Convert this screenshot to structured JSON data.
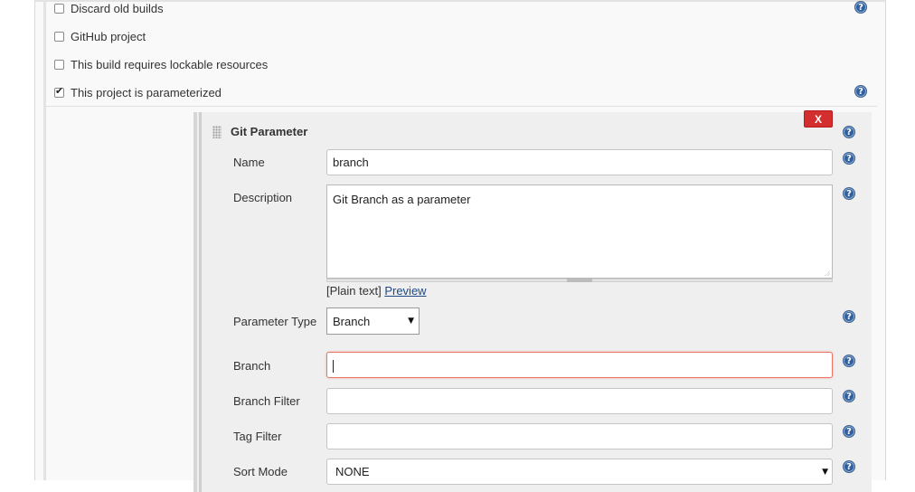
{
  "options": {
    "discard_old_builds": {
      "label": "Discard old builds",
      "checked": false
    },
    "github_project": {
      "label": "GitHub project",
      "checked": false
    },
    "lockable_resources": {
      "label": "This build requires lockable resources",
      "checked": false
    },
    "parameterized": {
      "label": "This project is parameterized",
      "checked": true
    }
  },
  "git_parameter": {
    "title": "Git Parameter",
    "delete_label": "X",
    "name": {
      "label": "Name",
      "value": "branch"
    },
    "description": {
      "label": "Description",
      "value": "Git Branch as a parameter",
      "format_text": "[Plain text]",
      "preview_link": "Preview"
    },
    "parameter_type": {
      "label": "Parameter Type",
      "value": "Branch"
    },
    "branch": {
      "label": "Branch",
      "value": ""
    },
    "branch_filter": {
      "label": "Branch Filter",
      "value": ""
    },
    "tag_filter": {
      "label": "Tag Filter",
      "value": ""
    },
    "sort_mode": {
      "label": "Sort Mode",
      "value": "NONE"
    }
  },
  "icons": {
    "help": "help-icon",
    "drag": "drag-handle-icon",
    "dropdown": "chevron-down-icon"
  },
  "colors": {
    "delete_button": "#d32f2f",
    "focus_border": "#e8776b",
    "help_icon": "#2f5f9e",
    "link": "#204a87"
  }
}
